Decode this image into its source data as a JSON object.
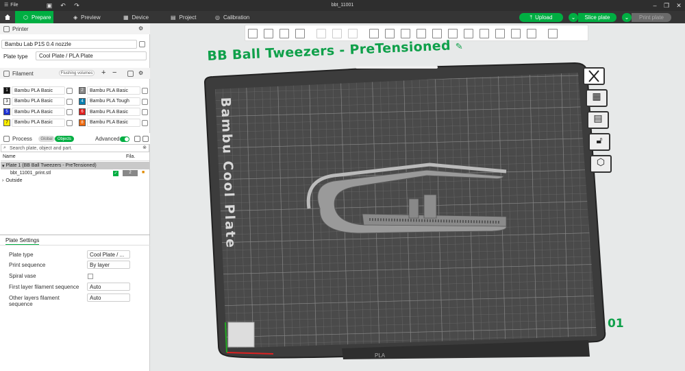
{
  "titlebar": {
    "file_label": "File",
    "window_title": "bbt_11001"
  },
  "nav": {
    "tabs": [
      {
        "label": "Prepare",
        "icon": "cube-icon",
        "active": true
      },
      {
        "label": "Preview",
        "icon": "preview-icon",
        "active": false
      },
      {
        "label": "Device",
        "icon": "device-icon",
        "active": false
      },
      {
        "label": "Project",
        "icon": "project-icon",
        "active": false
      },
      {
        "label": "Calibration",
        "icon": "calibration-icon",
        "active": false
      }
    ],
    "upload_label": "Upload",
    "slice_label": "Slice plate",
    "print_label": "Print plate",
    "accent": "#00ae42"
  },
  "printer": {
    "section_label": "Printer",
    "printer_name": "Bambu Lab P1S 0.4 nozzle",
    "plate_type_label": "Plate type",
    "plate_type_value": "Cool Plate / PLA Plate"
  },
  "filament": {
    "section_label": "Filament",
    "flushing_label": "Flushing volumes",
    "items": [
      {
        "num": "1",
        "color": "#111111",
        "name": "Bambu PLA Basic"
      },
      {
        "num": "2",
        "color": "#888888",
        "name": "Bambu PLA Basic"
      },
      {
        "num": "3",
        "color": "#ffffff",
        "name": "Bambu PLA Basic"
      },
      {
        "num": "4",
        "color": "#0a7fb0",
        "name": "Bambu PLA Tough"
      },
      {
        "num": "5",
        "color": "#1a2fd6",
        "name": "Bambu PLA Basic"
      },
      {
        "num": "6",
        "color": "#e02020",
        "name": "Bambu PLA Basic"
      },
      {
        "num": "7",
        "color": "#ffee00",
        "name": "Bambu PLA Basic"
      },
      {
        "num": "8",
        "color": "#ee6a10",
        "name": "Bambu PLA Basic"
      }
    ]
  },
  "process": {
    "section_label": "Process",
    "global_label": "Global",
    "objects_label": "Objects",
    "advanced_label": "Advanced"
  },
  "objects": {
    "search_placeholder": "Search plate, object and part.",
    "col_name": "Name",
    "col_fila": "Fila.",
    "plate_row": "Plate 1 (BB Ball Tweezers - PreTensioned)",
    "object_row": "bbt_11001_print.stl",
    "object_fila": "2",
    "outside_row": "Outside"
  },
  "plate_settings": {
    "tab_label": "Plate Settings",
    "rows": [
      {
        "label": "Plate type",
        "value": "Cool Plate / ..."
      },
      {
        "label": "Print sequence",
        "value": "By layer"
      },
      {
        "label": "Spiral vase",
        "value": ""
      },
      {
        "label": "First layer filament sequence",
        "value": "Auto"
      },
      {
        "label": "Other layers filament sequence",
        "value": "Auto"
      }
    ]
  },
  "viewport": {
    "plate_name": "BB Ball Tweezers - PreTensioned",
    "bed_label": "Bambu Cool Plate",
    "plate_number": "01",
    "bed_footer": "PLA"
  }
}
